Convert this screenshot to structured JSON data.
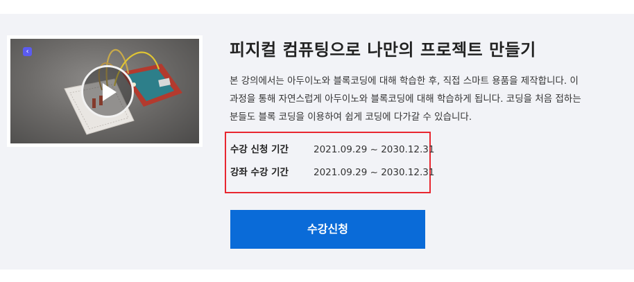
{
  "course": {
    "title": "피지컬 컴퓨팅으로 나만의 프로젝트 만들기",
    "description_lines": [
      "본 강의에서는 아두이노와 블록코딩에 대해 학습한 후, 직접 스마트 용품을 제작합니다. 이",
      "과정을 통해 자연스럽게 아두이노와 블록코딩에 대해 학습하게 됩니다. 코딩을 처음 접하는",
      "분들도 블록 코딩을 이용하여 쉽게 코딩에 다가갈 수 있습니다."
    ],
    "periods": [
      {
        "label": "수강 신청 기간",
        "value": "2021.09.29 ~ 2030.12.31"
      },
      {
        "label": "강좌 수강 기간",
        "value": "2021.09.29 ~ 2030.12.31"
      }
    ],
    "enroll_label": "수강신청"
  },
  "thumbnail": {
    "back_icon": "chevron-left-icon",
    "play_icon": "play-icon"
  },
  "colors": {
    "panel_bg": "#f2f3f7",
    "button_bg": "#0a6bd8",
    "highlight_border": "#e8262f",
    "back_chip": "#5b5bf0"
  }
}
